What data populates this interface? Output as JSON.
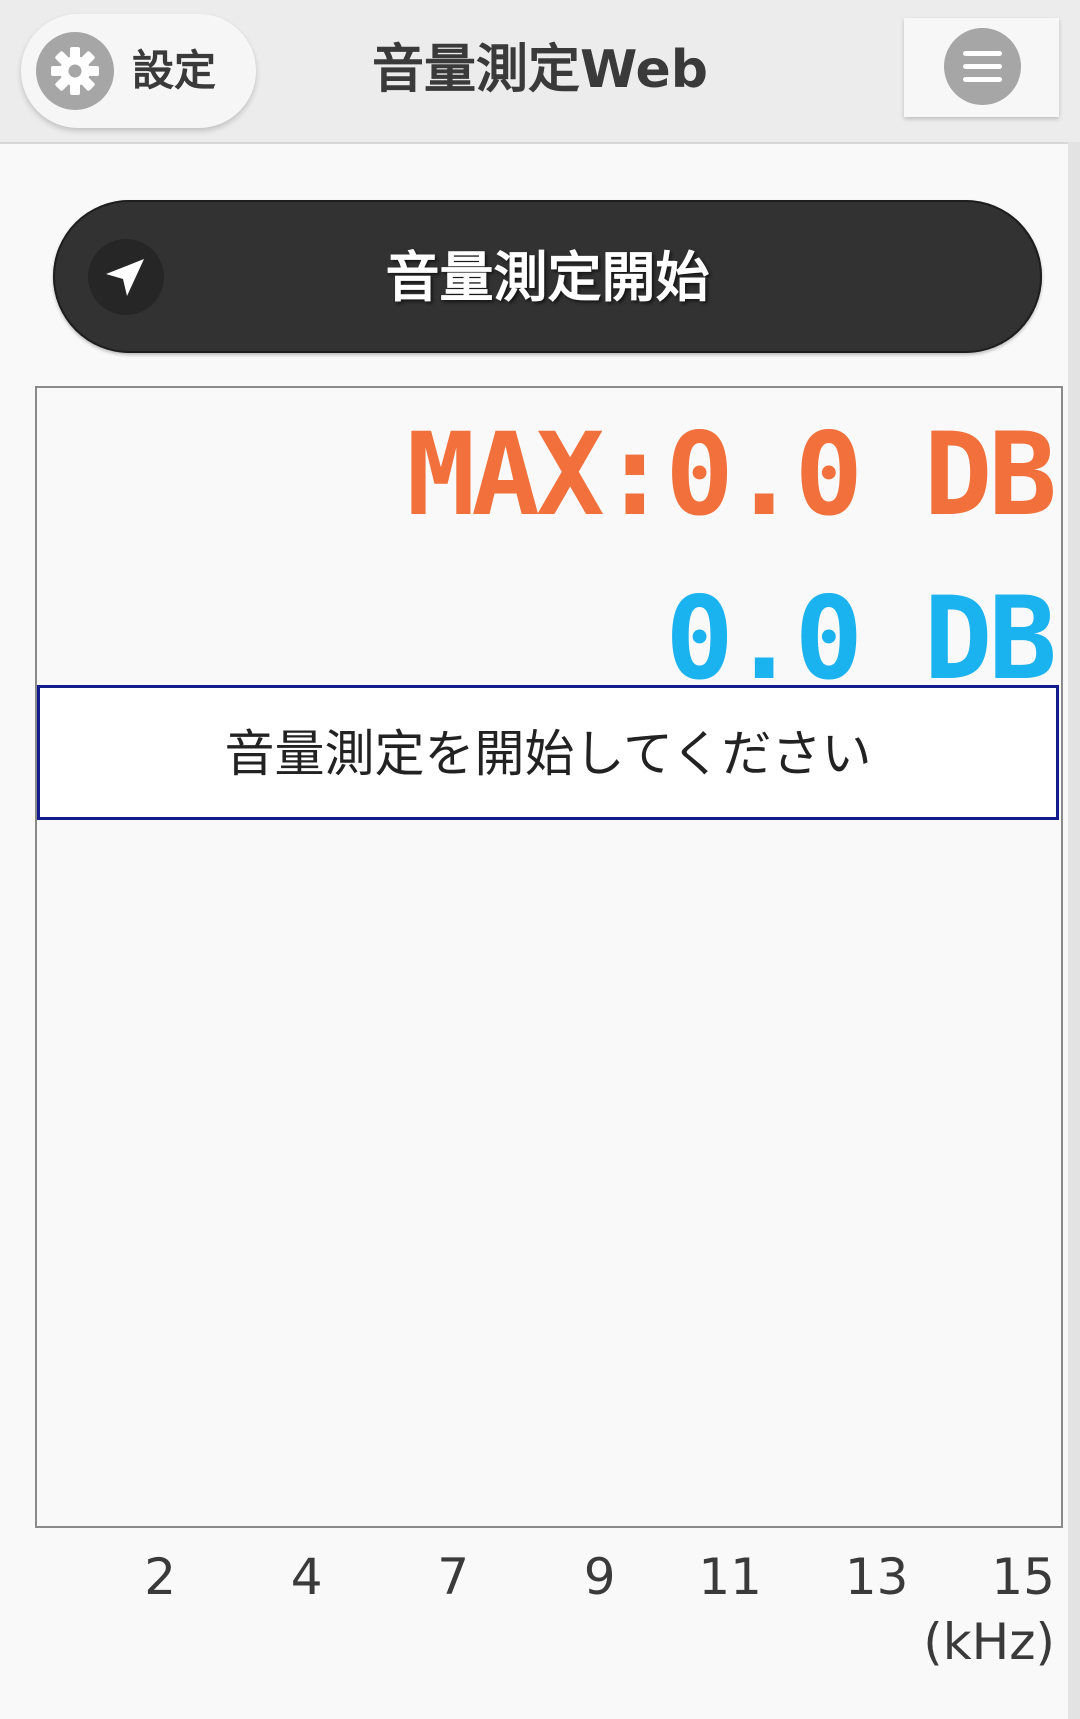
{
  "header": {
    "settings_label": "設定",
    "title": "音量測定Web",
    "settings_icon": "gear-icon",
    "menu_icon": "hamburger-menu-icon"
  },
  "start_button": {
    "label": "音量測定開始",
    "icon": "navigation-arrow-icon"
  },
  "meter": {
    "max_readout": "MAX:0.0 DB",
    "current_readout": "0.0 DB",
    "message": "音量測定を開始してください",
    "max_color": "#f2703b",
    "current_color": "#1ab2ef"
  },
  "chart_data": {
    "type": "bar",
    "x_ticks": [
      "2",
      "4",
      "7",
      "9",
      "11",
      "13",
      "15"
    ],
    "xlabel": "(kHz)",
    "values": []
  }
}
